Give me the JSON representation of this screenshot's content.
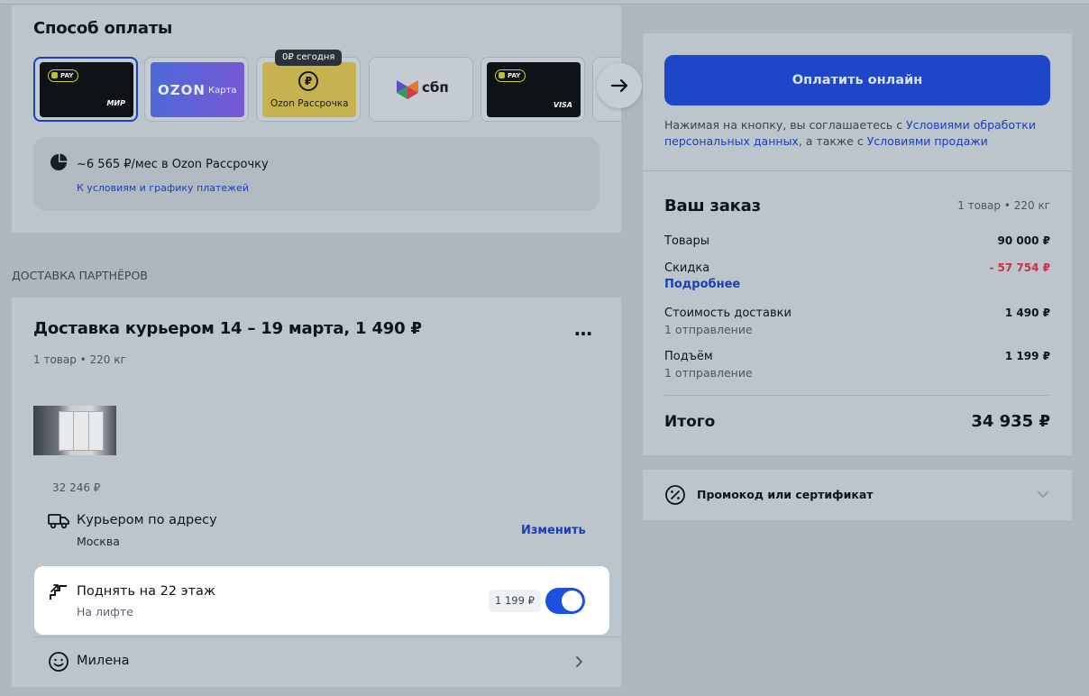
{
  "payment": {
    "title": "Способ оплаты",
    "cards": [
      {
        "type": "ozon-pay-mir",
        "badge": "PAY",
        "brand": "МИР"
      },
      {
        "type": "ozon-card",
        "logo": "OZON",
        "label": "Карта"
      },
      {
        "type": "ozon-installments",
        "badge": "0₽ сегодня",
        "label": "Ozon Рассрочка"
      },
      {
        "type": "sbp",
        "label": "сбп"
      },
      {
        "type": "ozon-pay-visa",
        "badge": "PAY",
        "brand": "VISA"
      }
    ],
    "installment_text": "~6 565 ₽/мес в Ozon Рассрочку",
    "installment_link": "К условиям и графику платежей"
  },
  "delivery": {
    "section_label": "ДОСТАВКА ПАРТНЁРОВ",
    "title": "Доставка курьером 14 – 19 марта, 1 490 ₽",
    "meta": "1 товар • 220 кг",
    "item_price": "32 246 ₽",
    "courier_title": "Курьером по адресу",
    "courier_city": "Москва",
    "change_link": "Изменить",
    "lift_title": "Поднять на 22 этаж",
    "lift_sub": "На лифте",
    "lift_price": "1 199 ₽",
    "lift_enabled": true,
    "recipient": "Милена"
  },
  "checkout": {
    "pay_button": "Оплатить онлайн",
    "agree_prefix": "Нажимая на кнопку, вы соглашаетесь с ",
    "agree_link1": "Условиями обработки",
    "agree_link1b": "персональных данных",
    "agree_mid": ", а также с ",
    "agree_link2": "Условиями продажи"
  },
  "order": {
    "title": "Ваш заказ",
    "meta": "1 товар • 220 кг",
    "goods_label": "Товары",
    "goods_value": "90 000 ₽",
    "discount_label": "Скидка",
    "discount_value": "- 57 754 ₽",
    "discount_link": "Подробнее",
    "shipping_label": "Стоимость доставки",
    "shipping_sub": "1 отправление",
    "shipping_value": "1 490 ₽",
    "lift_label": "Подъём",
    "lift_sub": "1 отправление",
    "lift_value": "1 199 ₽",
    "total_label": "Итого",
    "total_value": "34 935 ₽"
  },
  "promo": {
    "label": "Промокод или сертификат"
  },
  "colors": {
    "accent": "#1d4fe0",
    "discount": "#c8324a",
    "link": "#1b3fb0"
  }
}
